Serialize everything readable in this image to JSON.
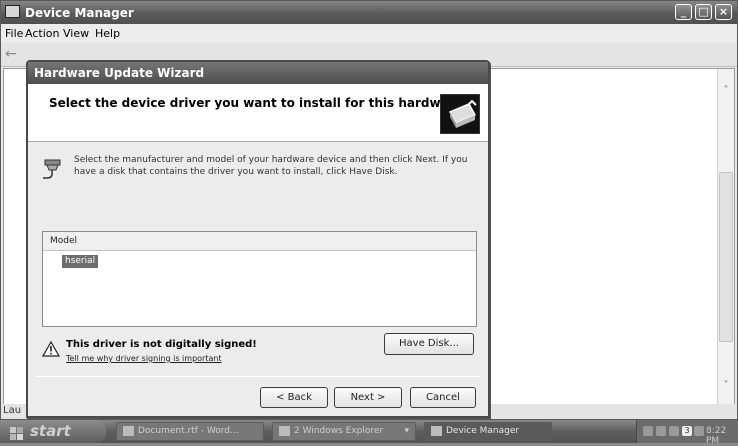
{
  "main_window": {
    "title": "Device Manager",
    "menu": [
      "File",
      "Action",
      "View",
      "Help"
    ],
    "status_text": "Lau"
  },
  "wizard": {
    "title": "Hardware Update Wizard",
    "heading": "Select the device driver you want to install for this hardware.",
    "instructions": "Select the manufacturer and model of your hardware device and then click Next. If you have a disk that contains the driver you want to install, click Have Disk.",
    "model_column": "Model",
    "models": [
      "hserial"
    ],
    "warning_title": "This driver is not digitally signed!",
    "warning_link": "Tell me why driver signing is important",
    "have_disk_label": "Have Disk...",
    "back_label": "< Back",
    "next_label": "Next >",
    "cancel_label": "Cancel"
  },
  "taskbar": {
    "start_label": "start",
    "tasks": [
      "Document.rtf - Word...",
      "2 Windows Explorer",
      "Device Manager"
    ],
    "tray_badge": "3",
    "clock": "8:22 PM"
  },
  "icons": {
    "app": "device-manager-icon",
    "back": "back-arrow-icon",
    "header": "hardware-wizard-icon",
    "instruction": "hardware-device-icon",
    "warning": "warning-triangle-icon"
  }
}
